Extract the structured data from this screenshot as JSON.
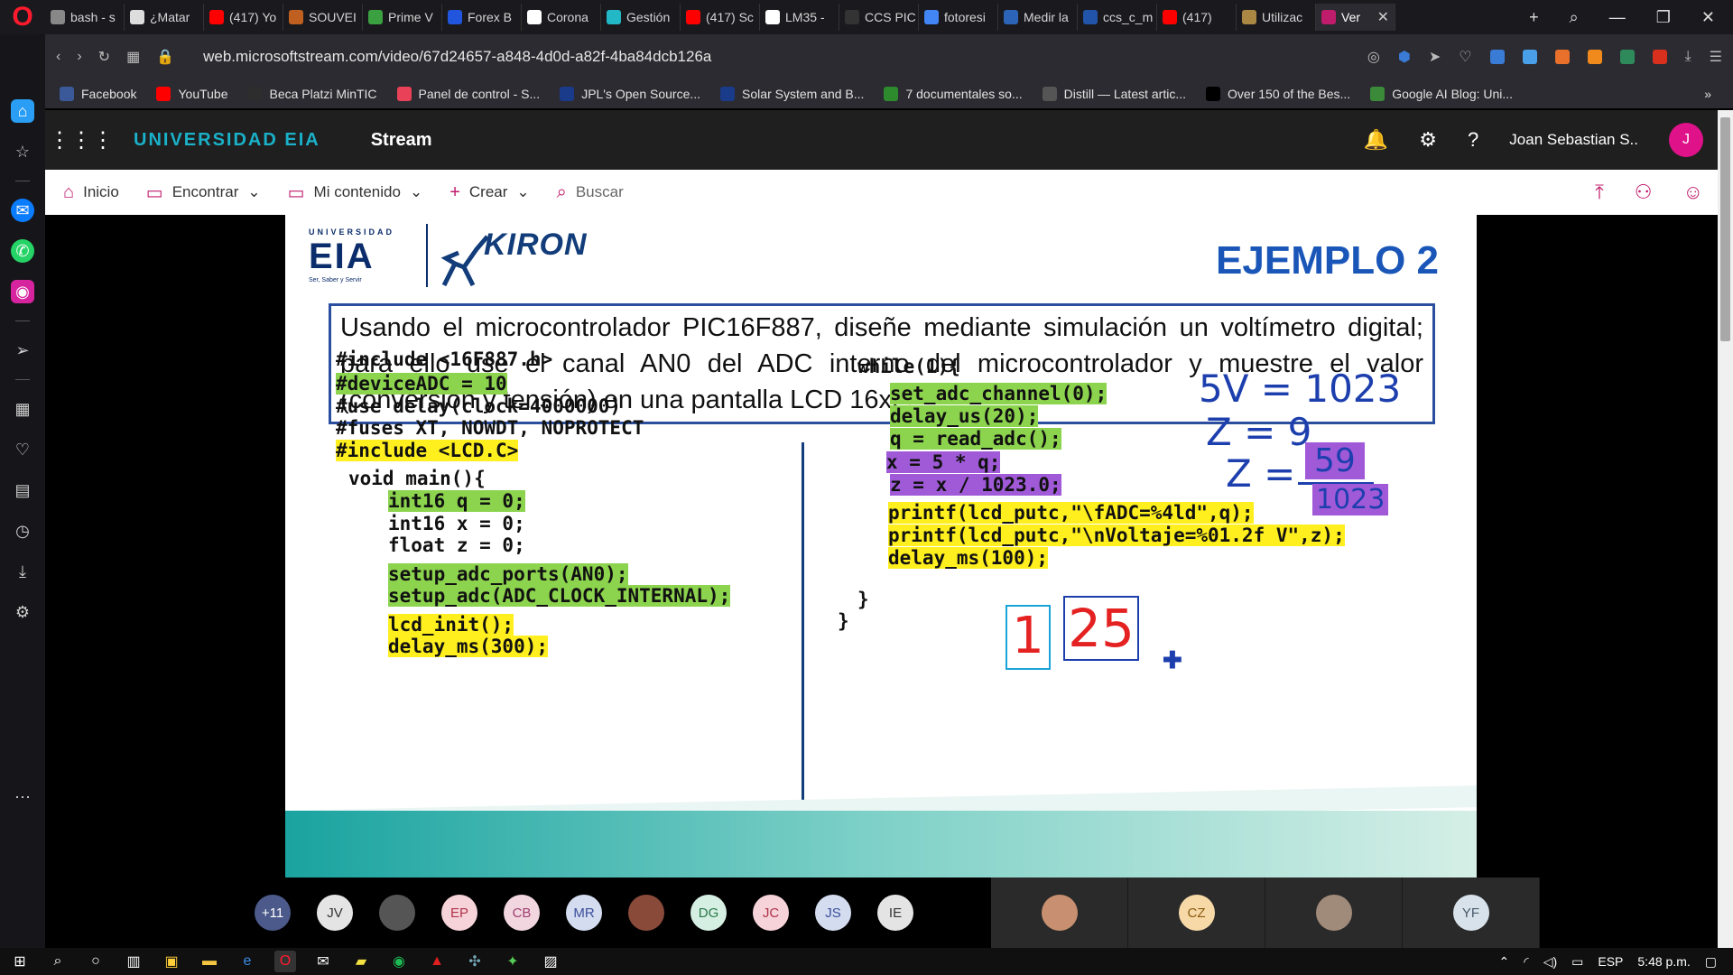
{
  "browser": {
    "tabs": [
      {
        "label": "bash - s",
        "color": "#888888"
      },
      {
        "label": "¿Matar",
        "color": "#dddddd"
      },
      {
        "label": "(417) Yo",
        "color": "#ff0000"
      },
      {
        "label": "SOUVEI",
        "color": "#c06020"
      },
      {
        "label": "Prime V",
        "color": "#3aa040"
      },
      {
        "label": "Forex B",
        "color": "#2255dd"
      },
      {
        "label": "Corona",
        "color": "#ffffff"
      },
      {
        "label": "Gestión",
        "color": "#22b8c6"
      },
      {
        "label": "(417) Sc",
        "color": "#ff0000"
      },
      {
        "label": "LM35 -",
        "color": "#ffffff"
      },
      {
        "label": "CCS PIC",
        "color": "#333333"
      },
      {
        "label": "fotoresi",
        "color": "#4285f4"
      },
      {
        "label": "Medir la",
        "color": "#2c65b8"
      },
      {
        "label": "ccs_c_m",
        "color": "#2255aa"
      },
      {
        "label": "(417)",
        "color": "#ff0000"
      },
      {
        "label": "Utilizac",
        "color": "#aa8844"
      },
      {
        "label": "Ver",
        "color": "#c01c6c"
      }
    ],
    "url": "web.microsoftstream.com/video/67d24657-a848-4d0d-a82f-4ba84dcb126a",
    "bookmarks": [
      {
        "label": "Facebook",
        "color": "#3b5998"
      },
      {
        "label": "YouTube",
        "color": "#ff0000"
      },
      {
        "label": "Beca Platzi MinTIC",
        "color": "#2d2d2d"
      },
      {
        "label": "Panel de control - S...",
        "color": "#e94157"
      },
      {
        "label": "JPL's Open Source...",
        "color": "#1a3a8a"
      },
      {
        "label": "Solar System and B...",
        "color": "#1a3a8a"
      },
      {
        "label": "7 documentales so...",
        "color": "#2d8a2d"
      },
      {
        "label": "Distill — Latest artic...",
        "color": "#555555"
      },
      {
        "label": "Over 150 of the Bes...",
        "color": "#000000"
      },
      {
        "label": "Google AI Blog: Uni...",
        "color": "#3a8a3a"
      }
    ]
  },
  "stream": {
    "org": "UNIVERSIDAD EIA",
    "title": "Stream",
    "user": "Joan Sebastian S..",
    "avatar": "J",
    "nav": [
      "Inicio",
      "Encontrar",
      "Mi contenido",
      "Crear",
      "Buscar"
    ]
  },
  "slide": {
    "logo_small": "UNIVERSIDAD",
    "logo_big": "EIA",
    "logo_tiny": "Ser, Saber y Servir",
    "kiron": "KIRON",
    "heading": "EJEMPLO 2",
    "problem": "Usando el microcontrolador PIC16F887, diseñe mediante simulación un voltímetro digital; para ello use el canal AN0 del ADC interno del microcontrolador y muestre el valor (conversión y tensión) en una pantalla LCD 16x2.",
    "code_left": [
      "#include <16F887.h>",
      "#deviceADC = 10",
      "#use delay(clock=4000000)",
      "#fuses XT, NOWDT, NOPROTECT",
      "#include <LCD.C>",
      "void main(){",
      "int16 q = 0;",
      "int16 x = 0;",
      "float z = 0;",
      "setup_adc_ports(AN0);",
      "setup_adc(ADC_CLOCK_INTERNAL);",
      "lcd_init();",
      "delay_ms(300);"
    ],
    "code_right": [
      "while(1){",
      "set_adc_channel(0);",
      "delay_us(20);",
      "q = read_adc();",
      "x = 5 * q;",
      "z = x / 1023.0;",
      "printf(lcd_putc,\"\\fADC=%4ld\",q);",
      "printf(lcd_putc,\"\\nVoltaje=%01.2f V\",z);",
      "delay_ms(100);",
      "}",
      "}"
    ],
    "handwriting": {
      "line1": "5V = 1023",
      "line2": "Z = 9",
      "line3_lhs": "Z =",
      "line3_num": "59",
      "line3_den": "1023",
      "digit_int": "1",
      "digit_dec": "25"
    }
  },
  "participants": {
    "more": "+11",
    "initials": [
      "JV",
      "",
      "EP",
      "CB",
      "MR",
      "",
      "DG",
      "JC",
      "JS",
      "IE"
    ],
    "tiles": [
      "",
      "CZ",
      "",
      "YF"
    ]
  },
  "taskbar": {
    "lang": "ESP",
    "time": "5:48 p.m."
  }
}
